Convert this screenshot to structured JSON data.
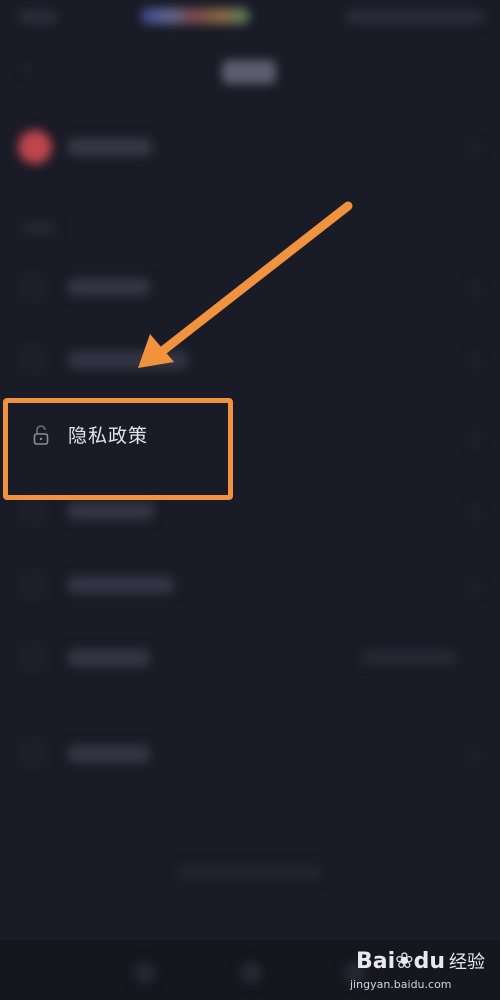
{
  "privacy_item": {
    "label": "隐私政策",
    "icon": "lock-icon"
  },
  "annotation": {
    "arrow_color": "#f0923e",
    "box_color": "#f0923e"
  },
  "watermark": {
    "logo": "Bai",
    "logo_suffix": "du",
    "logo_cn": "经验",
    "url": "jingyan.baidu.com"
  }
}
